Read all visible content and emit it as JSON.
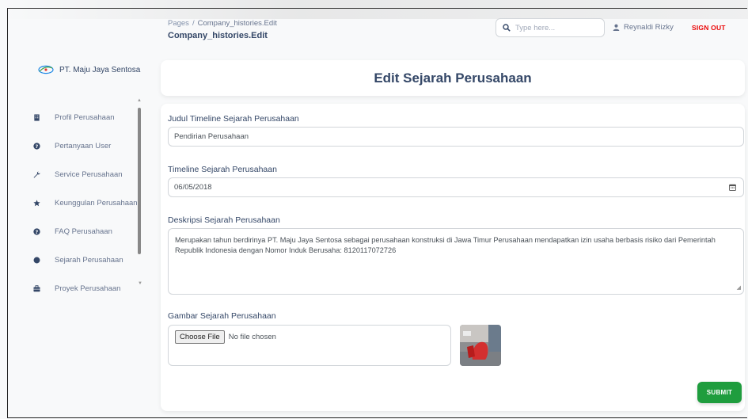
{
  "header": {
    "breadcrumb_root": "Pages",
    "breadcrumb_separator": "/",
    "breadcrumb_current": "Company_histories.Edit",
    "page_title": "Company_histories.Edit",
    "search_placeholder": "Type here...",
    "user_name": "Reynaldi Rizky",
    "signout_label": "SIGN OUT"
  },
  "sidebar": {
    "brand": "PT. Maju Jaya Sentosa",
    "items": [
      {
        "label": "Profil Perusahaan",
        "icon": "building-icon"
      },
      {
        "label": "Pertanyaan User",
        "icon": "question-icon"
      },
      {
        "label": "Service Perusahaan",
        "icon": "wrench-icon"
      },
      {
        "label": "Keunggulan Perusahaan",
        "icon": "star-icon"
      },
      {
        "label": "FAQ Perusahaan",
        "icon": "question-icon"
      },
      {
        "label": "Sejarah Perusahaan",
        "icon": "dot-icon"
      },
      {
        "label": "Proyek Perusahaan",
        "icon": "briefcase-icon"
      }
    ]
  },
  "main": {
    "title": "Edit Sejarah Perusahaan",
    "form": {
      "judul_label": "Judul Timeline Sejarah Perusahaan",
      "judul_value": "Pendirian Perusahaan",
      "timeline_label": "Timeline Sejarah Perusahaan",
      "timeline_value": "06/05/2018",
      "deskripsi_label": "Deskripsi Sejarah Perusahaan",
      "deskripsi_value": "Merupakan tahun berdirinya PT. Maju Jaya Sentosa sebagai perusahaan konstruksi di Jawa Timur Perusahaan mendapatkan izin usaha berbasis risiko dari Pemerintah Republik Indonesia dengan Nomor Induk Berusaha: 8120117072726",
      "gambar_label": "Gambar Sejarah Perusahaan",
      "choose_file_label": "Choose File",
      "no_file_label": "No file chosen",
      "submit_label": "SUBMIT"
    }
  },
  "colors": {
    "accent_red": "#ea0606",
    "submit_green": "#1f9d3e",
    "text_dark": "#344767"
  }
}
